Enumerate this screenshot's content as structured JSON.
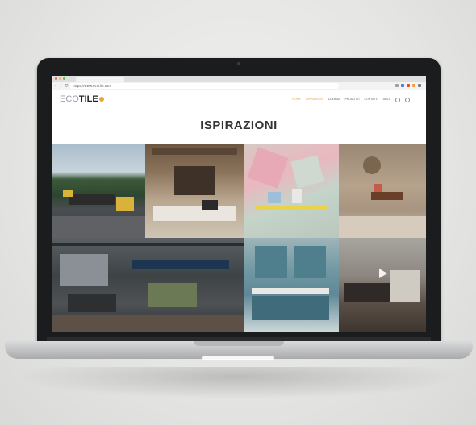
{
  "browser": {
    "url": "https://www.ecotile.com",
    "nav": "‹ › ⟳"
  },
  "site": {
    "logo_part1": "ECO",
    "logo_part2": "TILE",
    "menu": [
      "HOME",
      "ISPIRAZIONI",
      "AZIENDA",
      "PRODOTTI",
      "CONTATTI",
      "AREA"
    ],
    "title": "ISPIRAZIONI"
  },
  "colors": {
    "accent": "#e9a53a",
    "laptop_bezel": "#1b1c1e"
  },
  "icons": {
    "search": "search-icon",
    "cart": "cart-icon",
    "play": "play-icon"
  }
}
